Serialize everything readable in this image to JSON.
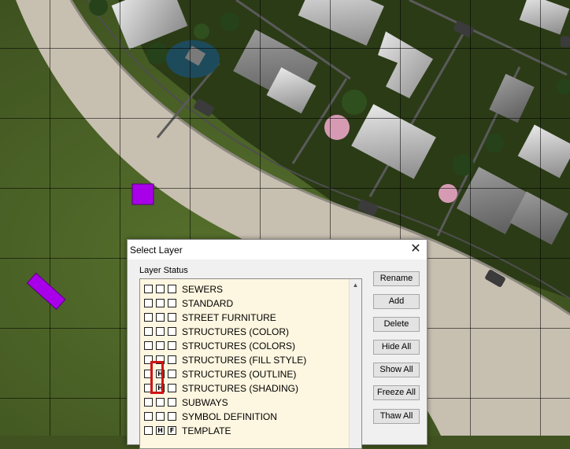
{
  "dialog": {
    "title": "Select Layer",
    "close_glyph": "✕",
    "group_label": "Layer Status"
  },
  "layers": [
    {
      "flag1": "",
      "flag2": "",
      "flag3": "",
      "name": "SEWERS"
    },
    {
      "flag1": "",
      "flag2": "",
      "flag3": "",
      "name": "STANDARD"
    },
    {
      "flag1": "",
      "flag2": "",
      "flag3": "",
      "name": "STREET FURNITURE"
    },
    {
      "flag1": "",
      "flag2": "",
      "flag3": "",
      "name": "STRUCTURES (COLOR)"
    },
    {
      "flag1": "",
      "flag2": "",
      "flag3": "",
      "name": "STRUCTURES (COLORS)"
    },
    {
      "flag1": "",
      "flag2": "",
      "flag3": "",
      "name": "STRUCTURES (FILL STYLE)"
    },
    {
      "flag1": "",
      "flag2": "H",
      "flag3": "",
      "name": "STRUCTURES (OUTLINE)"
    },
    {
      "flag1": "",
      "flag2": "H",
      "flag3": "",
      "name": "STRUCTURES (SHADING)"
    },
    {
      "flag1": "",
      "flag2": "",
      "flag3": "",
      "name": "SUBWAYS"
    },
    {
      "flag1": "",
      "flag2": "",
      "flag3": "",
      "name": "SYMBOL DEFINITION"
    },
    {
      "flag1": "",
      "flag2": "H",
      "flag3": "F",
      "name": "TEMPLATE"
    }
  ],
  "buttons": {
    "rename": "Rename",
    "add": "Add",
    "delete": "Delete",
    "hide_all": "Hide All",
    "show_all": "Show All",
    "freeze_all": "Freeze All",
    "thaw_all": "Thaw All"
  },
  "colors": {
    "map_tokens": "#a800e8",
    "highlight": "#d01414",
    "list_background": "#fdf6e0"
  },
  "icons": {
    "scroll_up": "▲"
  }
}
